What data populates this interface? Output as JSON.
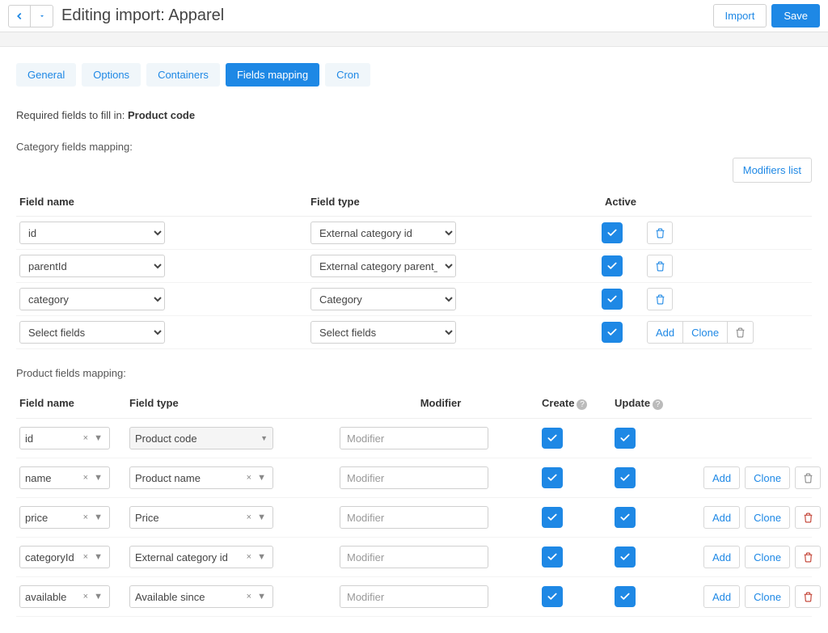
{
  "header": {
    "title": "Editing import: Apparel",
    "import_btn": "Import",
    "save_btn": "Save"
  },
  "tabs": [
    {
      "label": "General",
      "active": false
    },
    {
      "label": "Options",
      "active": false
    },
    {
      "label": "Containers",
      "active": false
    },
    {
      "label": "Fields mapping",
      "active": true
    },
    {
      "label": "Cron",
      "active": false
    }
  ],
  "required_hint": {
    "prefix": "Required fields to fill in: ",
    "value": "Product code"
  },
  "category_section": {
    "title": "Category fields mapping:",
    "modifiers_btn": "Modifiers list",
    "headers": {
      "field_name": "Field name",
      "field_type": "Field type",
      "active": "Active"
    },
    "rows": [
      {
        "field_name": "id",
        "field_type": "External category id",
        "active": true,
        "actions": "trash_blue"
      },
      {
        "field_name": "parentId",
        "field_type": "External category parent_id",
        "active": true,
        "actions": "trash_blue"
      },
      {
        "field_name": "category",
        "field_type": "Category",
        "active": true,
        "actions": "trash_blue"
      },
      {
        "field_name": "Select fields",
        "field_type": "Select fields",
        "active": true,
        "actions": "add_clone_trash_grey"
      }
    ],
    "add_label": "Add",
    "clone_label": "Clone"
  },
  "product_section": {
    "title": "Product fields mapping:",
    "headers": {
      "field_name": "Field name",
      "field_type": "Field type",
      "modifier": "Modifier",
      "create": "Create",
      "update": "Update"
    },
    "modifier_placeholder": "Modifier",
    "add_label": "Add",
    "clone_label": "Clone",
    "rows": [
      {
        "field_name": "id",
        "field_type": "Product code",
        "type_locked": true,
        "create": true,
        "update": true,
        "actions": "none"
      },
      {
        "field_name": "name",
        "field_type": "Product name",
        "type_locked": false,
        "create": true,
        "update": true,
        "actions": "add_clone_trash_grey"
      },
      {
        "field_name": "price",
        "field_type": "Price",
        "type_locked": false,
        "create": true,
        "update": true,
        "actions": "add_clone_trash_red"
      },
      {
        "field_name": "categoryId",
        "field_type": "External category id",
        "type_locked": false,
        "create": true,
        "update": true,
        "actions": "add_clone_trash_red"
      },
      {
        "field_name": "available",
        "field_type": "Available since",
        "type_locked": false,
        "create": true,
        "update": true,
        "actions": "add_clone_trash_red"
      }
    ]
  }
}
